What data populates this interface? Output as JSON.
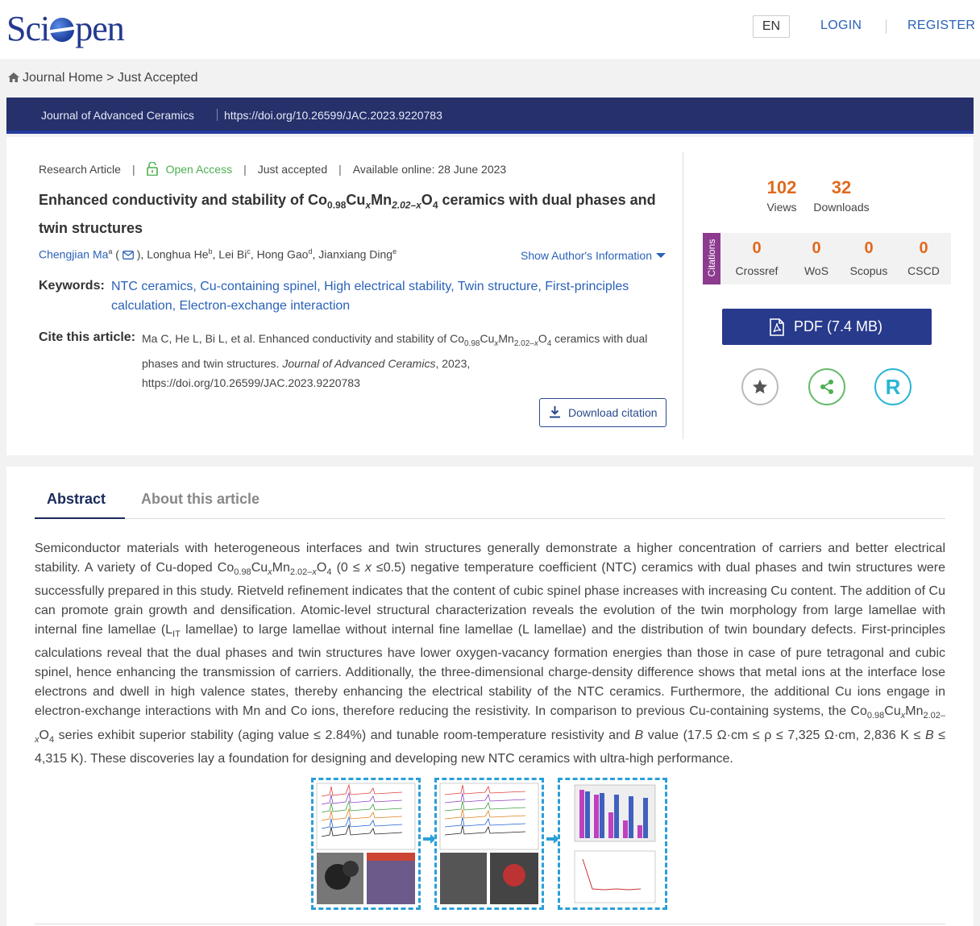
{
  "header": {
    "logo": "Sciopen",
    "lang": "EN",
    "login": "LOGIN",
    "register": "REGISTER"
  },
  "breadcrumb": {
    "home": "Journal Home",
    "separator": ">",
    "current": "Just Accepted"
  },
  "journal_bar": {
    "name": "Journal of Advanced Ceramics",
    "doi": "https://doi.org/10.26599/JAC.2023.9220783"
  },
  "article": {
    "type": "Research Article",
    "access": "Open Access",
    "status": "Just accepted",
    "available": "Available online: 28 June 2023",
    "title_parts": [
      "Enhanced conductivity and stability of Co",
      "0.98",
      "Cu",
      "x",
      "Mn",
      "2.02–x",
      "O",
      "4",
      " ceramics with dual phases and twin structures"
    ],
    "authors": {
      "first": "Chengjian Ma",
      "first_sup": "a",
      "others": [
        {
          "name": "Longhua He",
          "sup": "b"
        },
        {
          "name": "Lei Bi",
          "sup": "c"
        },
        {
          "name": "Hong Gao",
          "sup": "d"
        },
        {
          "name": "Jianxiang Ding",
          "sup": "e"
        }
      ],
      "show_info": "Show Author's Information"
    },
    "keywords_label": "Keywords:",
    "keywords": "NTC ceramics, Cu-containing spinel, High electrical stability, Twin structure, First-principles calculation, Electron-exchange interaction",
    "cite_label": "Cite this article:",
    "cite": {
      "authors": "Ma C, He L, Bi L, et al. Enhanced conductivity and stability of Co",
      "journal": "Journal of Advanced Ceramics",
      "year": ", 2023,",
      "doi": "https://doi.org/10.26599/JAC.2023.9220783"
    },
    "download_citation": "Download citation"
  },
  "stats": {
    "views": "102",
    "views_label": "Views",
    "downloads": "32",
    "downloads_label": "Downloads",
    "citations_tab": "Citations",
    "citations": [
      {
        "count": "0",
        "source": "Crossref"
      },
      {
        "count": "0",
        "source": "WoS"
      },
      {
        "count": "0",
        "source": "Scopus"
      },
      {
        "count": "0",
        "source": "CSCD"
      }
    ],
    "pdf_label": "PDF (7.4 MB)",
    "r_label": "R"
  },
  "tabs": {
    "abstract": "Abstract",
    "about": "About this article"
  },
  "abstract_text": {
    "p1": "Semiconductor materials with heterogeneous interfaces and twin structures generally demonstrate a higher concentration of carriers and better electrical stability. A variety of Cu-doped Co",
    "p2": "negative temperature coefficient (NTC) ceramics with dual phases and twin structures were successfully prepared in this study. Rietveld refinement indicates that the content of cubic spinel phase increases with increasing Cu content. The addition of Cu can promote grain growth and densification. Atomic-level structural characterization reveals the evolution of the twin morphology from large lamellae with internal fine lamellae (L",
    "p3": " lamellae) to large lamellae without internal fine lamellae (L lamellae) and the distribution of twin boundary defects. First-principles calculations reveal that the dual phases and twin structures have lower oxygen-vacancy formation energies than those in case of pure tetragonal and cubic spinel, hence enhancing the transmission of carriers. Additionally, the three-dimensional charge-density difference shows that metal ions at the interface lose electrons and dwell in high valence states, thereby enhancing the electrical stability of the NTC ceramics. Furthermore, the additional Cu ions engage in electron-exchange interactions with Mn and Co ions, therefore reducing the resistivity. In comparison to previous Cu-containing systems, the Co",
    "p4": " series exhibit superior stability (aging value ≤ 2.84%) and tunable room-temperature resistivity and ",
    "p5": " value (17.5 Ω·cm ≤ ρ ≤ 7,325 Ω·cm, 2,836 K ≤ ",
    "p6": " ≤ 4,315 K). These discoveries lay a foundation for designing and developing new NTC ceramics with ultra-high performance."
  }
}
